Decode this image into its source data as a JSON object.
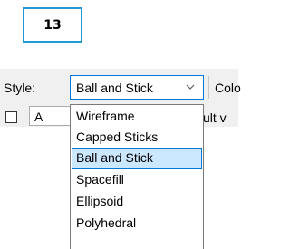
{
  "step_badge": "13",
  "toolbar": {
    "style_label": "Style:",
    "style_value": "Ball and Stick",
    "color_label_partial": "Colo",
    "row2_field_partial": "A",
    "row2_partial_text": "ult v"
  },
  "dropdown": {
    "options": [
      {
        "label": "Wireframe",
        "selected": false
      },
      {
        "label": "Capped Sticks",
        "selected": false
      },
      {
        "label": "Ball and Stick",
        "selected": true
      },
      {
        "label": "Spacefill",
        "selected": false
      },
      {
        "label": "Ellipsoid",
        "selected": false
      },
      {
        "label": "Polyhedral",
        "selected": false
      }
    ]
  },
  "colors": {
    "badge_border": "#1e9bd7",
    "focus_border": "#0078d7",
    "selection_fill": "#cce8ff",
    "toolbar_bg": "#f0f0f0"
  },
  "icons": {
    "chevron": "chevron-down-icon",
    "checkbox": "checkbox-icon"
  }
}
